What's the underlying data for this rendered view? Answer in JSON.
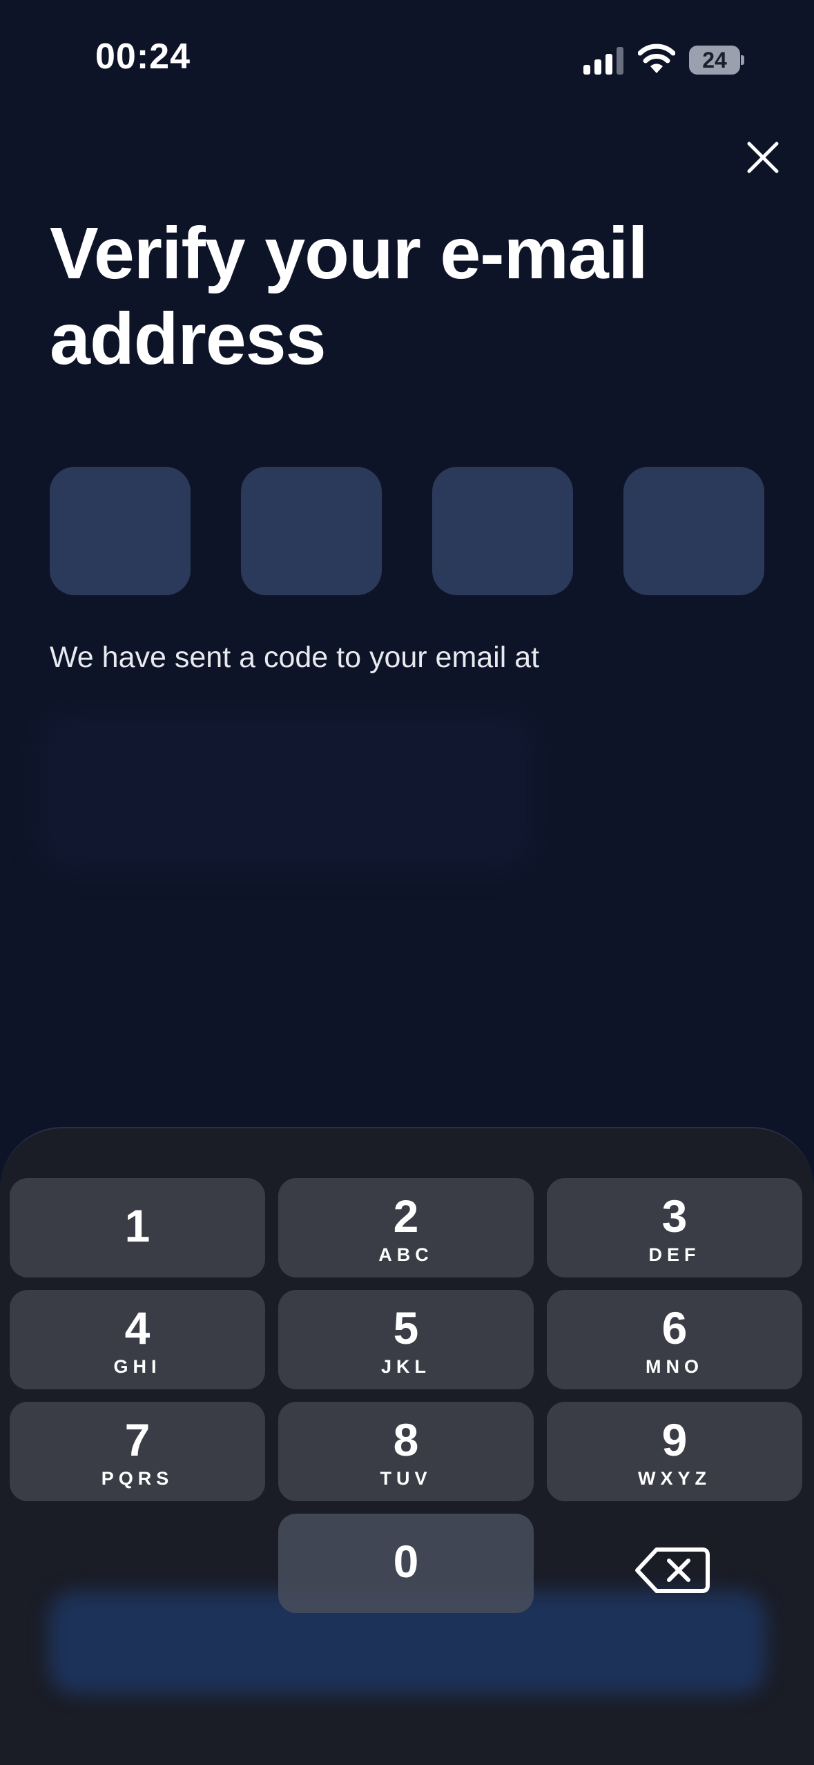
{
  "status_bar": {
    "time": "00:24",
    "battery": "24"
  },
  "header": {
    "title_line1": "Verify your e-mail",
    "title_line2": "address"
  },
  "code_boxes": [
    "",
    "",
    "",
    ""
  ],
  "subtitle": "We have sent a code to your email at",
  "keypad": {
    "keys": [
      {
        "num": "1",
        "letters": ""
      },
      {
        "num": "2",
        "letters": "ABC"
      },
      {
        "num": "3",
        "letters": "DEF"
      },
      {
        "num": "4",
        "letters": "GHI"
      },
      {
        "num": "5",
        "letters": "JKL"
      },
      {
        "num": "6",
        "letters": "MNO"
      },
      {
        "num": "7",
        "letters": "PQRS"
      },
      {
        "num": "8",
        "letters": "TUV"
      },
      {
        "num": "9",
        "letters": "WXYZ"
      }
    ],
    "zero": "0"
  },
  "icons": {
    "close": "close-icon",
    "backspace": "backspace-icon",
    "signal": "cellular-signal-icon",
    "wifi": "wifi-icon",
    "battery": "battery-icon"
  },
  "colors": {
    "background": "#0e1428",
    "code_box": "#2b3a5a",
    "keypad_bg": "#1a1c26",
    "key_bg": "#3a3d46"
  }
}
